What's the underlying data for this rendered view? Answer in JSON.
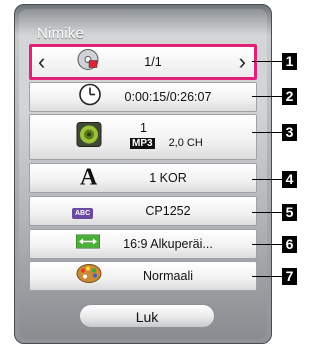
{
  "menu": {
    "title": "Nimike",
    "close_label": "Luk",
    "rows": [
      {
        "name": "title",
        "icon": "disc-icon",
        "value": "1/1",
        "selected": true
      },
      {
        "name": "time",
        "icon": "clock-icon",
        "value": "0:00:15/0:26:07"
      },
      {
        "name": "audio",
        "icon": "speaker-icon",
        "value": "1",
        "format": "MP3",
        "channels": "2,0 CH"
      },
      {
        "name": "subtitle",
        "icon": "letter-a-icon",
        "value": "1 KOR"
      },
      {
        "name": "code-page",
        "icon": "abc-icon",
        "value": "CP1252",
        "icon_text": "ABC"
      },
      {
        "name": "aspect-ratio",
        "icon": "stretch-icon",
        "value": "16:9 Alkuperäi..."
      },
      {
        "name": "picture-mode",
        "icon": "palette-icon",
        "value": "Normaali"
      }
    ]
  },
  "callouts": [
    "1",
    "2",
    "3",
    "4",
    "5",
    "6",
    "7"
  ],
  "colors": {
    "highlight": "#e0217a"
  }
}
